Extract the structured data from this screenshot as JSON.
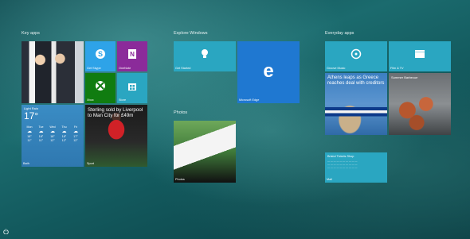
{
  "groups": {
    "key_apps": "Key apps",
    "explore": "Explore Windows",
    "photos": "Photos",
    "everyday": "Everyday apps"
  },
  "tiles": {
    "news_people": "",
    "get_skype": "Get Skype",
    "onenote": "OneNote",
    "xbox": "Xbox",
    "store": "Store",
    "weather": {
      "label": "Light Rain",
      "temp": "17°",
      "days": [
        {
          "d": "Mon",
          "hi": "18°",
          "lo": "11°"
        },
        {
          "d": "Tue",
          "hi": "18°",
          "lo": "11°"
        },
        {
          "d": "Wed",
          "hi": "18°",
          "lo": "12°"
        },
        {
          "d": "Thu",
          "hi": "18°",
          "lo": "12°"
        },
        {
          "d": "Fri",
          "hi": "17°",
          "lo": "12°"
        }
      ],
      "city": "Bath"
    },
    "sport": {
      "headline": "Sterling sold by Liverpool to Man City for £49m",
      "label": "Sport"
    },
    "get_started": "Get Started",
    "edge": "Microsoft Edge",
    "photos_tile": "Photos",
    "groove": "Groove Music",
    "film_tv": "Film & TV",
    "news_greece": {
      "headline": "Athens leaps as Greece reaches deal with creditors",
      "label": ""
    },
    "food": {
      "headline": "Summer Barbecue",
      "label": ""
    },
    "mail": {
      "title": "Bristol Tickets Shop",
      "lines": [
        "— — — — —   — — — — —",
        "— — — — — — — — — —",
        "— — — — — — — — — —"
      ],
      "label": "Mail"
    }
  },
  "colors": {
    "blue_tile": "#2ea3e8",
    "purple_tile": "#8b2b9a",
    "green_tile": "#107c10",
    "teal_tile": "#2aa6c1",
    "edge_tile": "#1f78d1"
  },
  "icons": {
    "power": "power-icon"
  }
}
